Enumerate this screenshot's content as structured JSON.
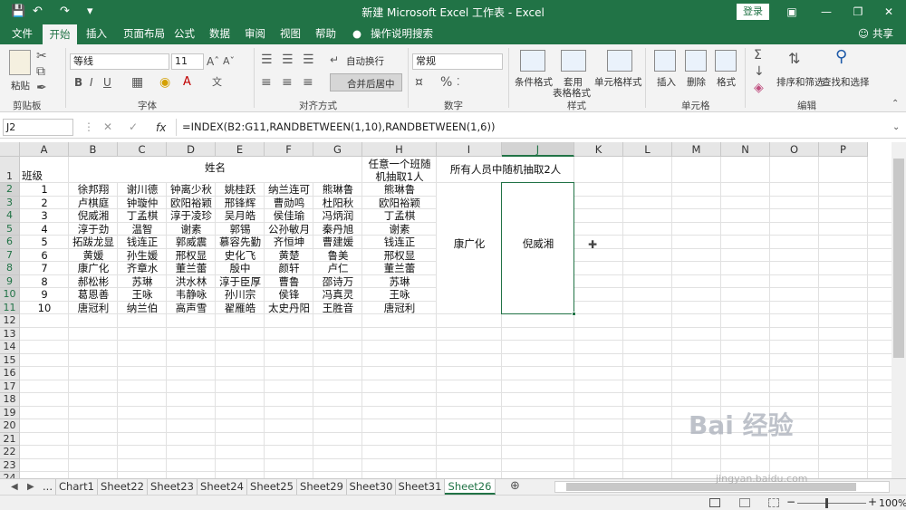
{
  "app": {
    "title": "新建 Microsoft Excel 工作表 - Excel",
    "login": "登录",
    "share": "共享",
    "colors": {
      "brand": "#217346",
      "selection": "#217346"
    }
  },
  "menu": {
    "tabs": [
      "文件",
      "开始",
      "插入",
      "页面布局",
      "公式",
      "数据",
      "审阅",
      "视图",
      "帮助"
    ],
    "tell_me": "操作说明搜索"
  },
  "ribbon": {
    "paste": "粘贴",
    "font_name": "等线",
    "font_size": "11",
    "wrap_text": "自动换行",
    "merge_center": "合并后居中",
    "number_format": "常规",
    "cond_format": "条件格式",
    "table_format_1": "套用",
    "table_format_2": "表格格式",
    "cell_style": "单元格样式",
    "insert": "插入",
    "delete": "删除",
    "format": "格式",
    "sort_filter": "排序和筛选",
    "find_select": "查找和选择",
    "groups": [
      "剪贴板",
      "字体",
      "对齐方式",
      "数字",
      "样式",
      "单元格",
      "编辑"
    ]
  },
  "formula_bar": {
    "name_box": "J2",
    "fx": "fx",
    "formula": "=INDEX(B2:G11,RANDBETWEEN(1,10),RANDBETWEEN(1,6))"
  },
  "columns": [
    "A",
    "B",
    "C",
    "D",
    "E",
    "F",
    "G",
    "H",
    "I",
    "J",
    "K",
    "L",
    "M",
    "N",
    "O",
    "P"
  ],
  "rows": [
    "1",
    "2",
    "3",
    "4",
    "5",
    "6",
    "7",
    "8",
    "9",
    "10",
    "11",
    "12",
    "13",
    "14",
    "15",
    "16",
    "17",
    "18",
    "19",
    "20",
    "21",
    "22",
    "23",
    "24"
  ],
  "sheet": {
    "a1": "班级",
    "b1": "姓名",
    "h1_line1": "任意一个班随",
    "h1_line2": "机抽取1人",
    "ij1": "所有人员中随机抽取2人",
    "i_result": "康广化",
    "j_result": "倪威湘",
    "data": [
      [
        "1",
        "徐邦翔",
        "谢川德",
        "钟离少秋",
        "姚桂跃",
        "纳兰连可",
        "熊琳鲁",
        "熊琳鲁"
      ],
      [
        "2",
        "卢棋庭",
        "钟璇仲",
        "欧阳裕颖",
        "邢锋辉",
        "曹勋鸣",
        "杜阳秋",
        "欧阳裕颖"
      ],
      [
        "3",
        "倪威湘",
        "丁孟棋",
        "淳于凌珍",
        "吴月皓",
        "侯佳瑜",
        "冯炳润",
        "丁孟棋"
      ],
      [
        "4",
        "淳于劲",
        "温智",
        "谢素",
        "郭锡",
        "公孙敏月",
        "秦丹旭",
        "谢素"
      ],
      [
        "5",
        "拓跋龙显",
        "钱连正",
        "郭威震",
        "慕容先勤",
        "齐恒坤",
        "曹建媛",
        "钱连正"
      ],
      [
        "6",
        "黄媛",
        "孙生媛",
        "邢权显",
        "史化飞",
        "黄楚",
        "鲁美",
        "邢权显"
      ],
      [
        "7",
        "康广化",
        "齐章水",
        "董兰蕾",
        "殷中",
        "颜轩",
        "卢仁",
        "董兰蕾"
      ],
      [
        "8",
        "郝松彬",
        "苏琳",
        "洪水林",
        "淳于臣厚",
        "曹鲁",
        "邵诗万",
        "苏琳"
      ],
      [
        "9",
        "葛恩善",
        "王咏",
        "韦静咏",
        "孙川宗",
        "侯锋",
        "冯真灵",
        "王咏"
      ],
      [
        "10",
        "唐冠利",
        "纳兰伯",
        "高声雪",
        "翟雁皓",
        "太史丹阳",
        "王胜音",
        "唐冠利"
      ]
    ]
  },
  "sheet_tabs": [
    "...",
    "Chart1",
    "Sheet22",
    "Sheet23",
    "Sheet24",
    "Sheet25",
    "Sheet29",
    "Sheet30",
    "Sheet31",
    "Sheet26"
  ],
  "active_sheet": "Sheet26",
  "status": {
    "zoom": "100%",
    "minus": "−",
    "plus": "+"
  },
  "watermark": {
    "main": "Bai 经验",
    "sub": "jingyan.baidu.com"
  }
}
